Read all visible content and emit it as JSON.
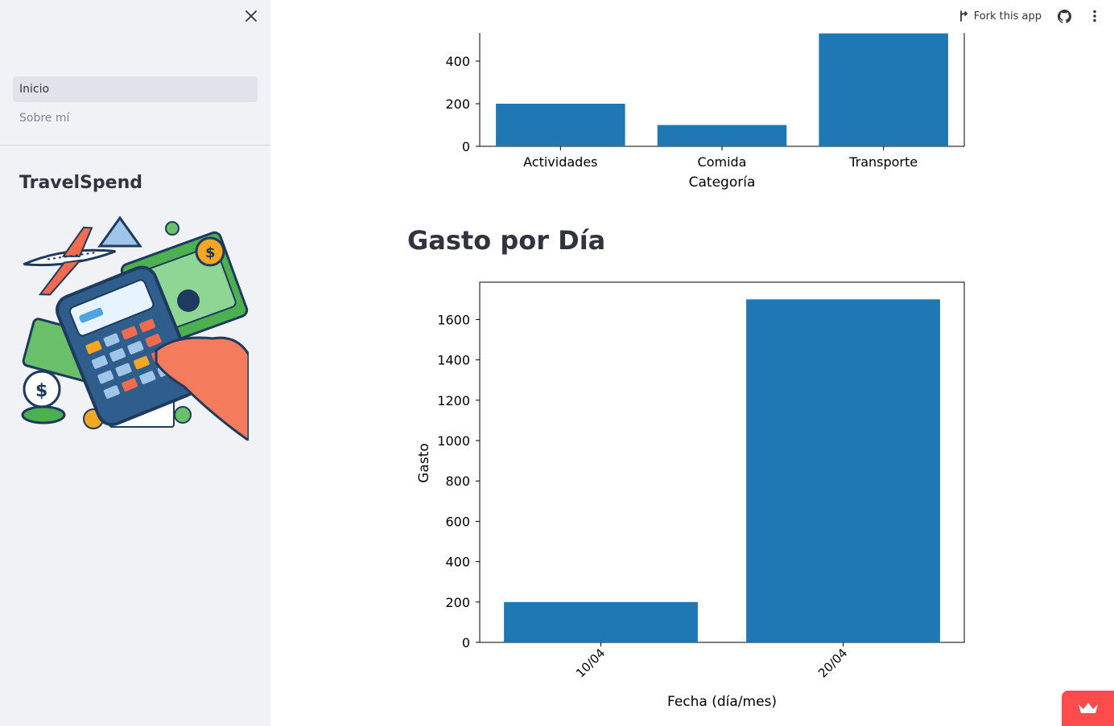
{
  "app": {
    "title": "TravelSpend"
  },
  "sidebar": {
    "close_icon": "close-icon",
    "items": [
      {
        "label": "Inicio",
        "active": true
      },
      {
        "label": "Sobre mí",
        "active": false
      }
    ],
    "illustration": "travel-expense-calculator-illustration"
  },
  "topbar": {
    "fork_label": "Fork this app",
    "fork_icon": "fork-icon",
    "github_icon": "github-icon",
    "menu_icon": "kebab-menu-icon"
  },
  "main": {
    "section_title": "Gasto por Día"
  },
  "colors": {
    "bar": "#1f77b4",
    "accent": "#ff4b4b",
    "sidebar_bg": "#f0f2f6"
  },
  "chart_data": [
    {
      "type": "bar",
      "categories": [
        "Actividades",
        "Comida",
        "Transporte"
      ],
      "values": [
        200,
        100,
        530
      ],
      "xlabel": "Categoría",
      "ylabel": "",
      "yticks": [
        0,
        200,
        400
      ],
      "cropped_top": true
    },
    {
      "type": "bar",
      "categories": [
        "10/04",
        "20/04"
      ],
      "values": [
        200,
        1700
      ],
      "xlabel": "Fecha (día/mes)",
      "ylabel": "Gasto",
      "ylim": [
        0,
        1785
      ],
      "yticks": [
        0,
        200,
        400,
        600,
        800,
        1000,
        1200,
        1400,
        1600
      ],
      "xtick_rotation": 45
    }
  ]
}
